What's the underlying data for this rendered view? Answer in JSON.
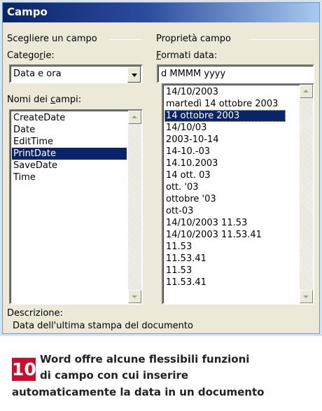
{
  "window": {
    "title": "Campo"
  },
  "left_group": {
    "title": "Scegliere un campo",
    "categories_label": "Categorie:",
    "categories_value": "Data e ora",
    "field_names_label": "Nomi dei campi:",
    "field_names": [
      "CreateDate",
      "Date",
      "EditTime",
      "PrintDate",
      "SaveDate",
      "Time"
    ],
    "selected_field": "PrintDate"
  },
  "right_group": {
    "title": "Proprietà campo",
    "date_formats_label": "Formati data:",
    "date_format_value": "d MMMM yyyy",
    "date_formats": [
      "14/10/2003",
      "martedì 14 ottobre 2003",
      "14 ottobre 2003",
      "14/10/03",
      "2003-10-14",
      "14-10.-03",
      "14.10.2003",
      "14 ott. 03",
      "ott. '03",
      "ottobre '03",
      "ott-03",
      "14/10/2003 11.53",
      "14/10/2003 11.53.41",
      "11.53",
      "11.53.41",
      "11.53",
      "11.53.41"
    ],
    "selected_format": "14 ottobre 2003"
  },
  "description": {
    "label": "Descrizione:",
    "text": "Data dell'ultima stampa del documento"
  },
  "caption": {
    "number": "10",
    "line1": "Word offre alcune flessibili funzioni",
    "line2": "di campo con cui inserire",
    "line3": "automaticamente la data in un documento"
  },
  "colors": {
    "title_bar_start": "#0a246a",
    "title_bar_end": "#a6caf0",
    "dialog_background": "#ece9d8",
    "selection": "#0a246a",
    "badge": "#c8102e",
    "frame": "#d6e5ec"
  },
  "icons": [
    "dropdown-arrow-icon",
    "scroll-up-icon",
    "scroll-down-icon"
  ]
}
